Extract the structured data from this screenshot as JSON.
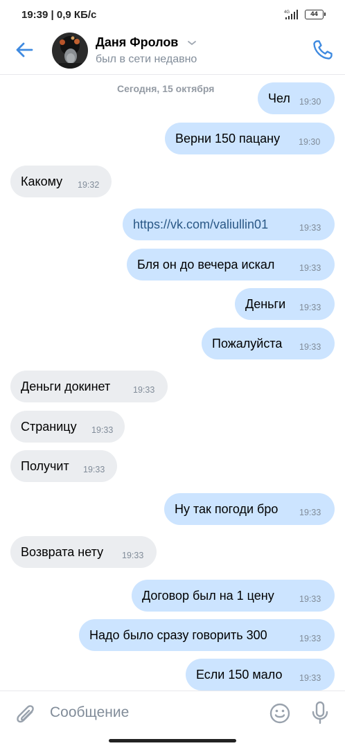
{
  "status_bar": {
    "time_speed": "19:39 | 0,9 КБ/с",
    "network": "4G",
    "battery": "44"
  },
  "header": {
    "contact_name": "Даня Фролов",
    "contact_status": "был в сети недавно",
    "icons": {
      "back": "arrow-left-icon",
      "chevron": "chevron-down-icon",
      "call": "phone-icon"
    }
  },
  "chat": {
    "date_separator": "Сегодня, 15 октября",
    "messages": [
      {
        "direction": "out",
        "text": "Чел",
        "time": "19:30"
      },
      {
        "direction": "out",
        "text": "Верни 150 пацану",
        "time": "19:30"
      },
      {
        "direction": "in",
        "text": "Какому",
        "time": "19:32"
      },
      {
        "direction": "out",
        "text": "https://vk.com/valiullin01",
        "time": "19:33",
        "link": true
      },
      {
        "direction": "out",
        "text": "Бля он до вечера искал",
        "time": "19:33"
      },
      {
        "direction": "out",
        "text": "Деньги",
        "time": "19:33"
      },
      {
        "direction": "out",
        "text": "Пожалуйста",
        "time": "19:33"
      },
      {
        "direction": "in",
        "text": "Деньги докинет",
        "time": "19:33"
      },
      {
        "direction": "in",
        "text": "Страницу",
        "time": "19:33"
      },
      {
        "direction": "in",
        "text": "Получит",
        "time": "19:33"
      },
      {
        "direction": "out",
        "text": "Ну так погоди бро",
        "time": "19:33"
      },
      {
        "direction": "in",
        "text": "Возврата нету",
        "time": "19:33"
      },
      {
        "direction": "out",
        "text": "Договор был на 1 цену",
        "time": "19:33"
      },
      {
        "direction": "out",
        "text": "Надо было сразу говорить 300",
        "time": "19:33"
      },
      {
        "direction": "out",
        "text": "Если 150 мало",
        "time": "19:33"
      }
    ]
  },
  "composer": {
    "placeholder": "Сообщение",
    "value": "",
    "icons": {
      "attach": "paperclip-icon",
      "emoji": "emoji-icon",
      "mic": "microphone-icon"
    }
  },
  "colors": {
    "accent": "#3f8ae0",
    "outgoing_bubble": "#cce4ff",
    "incoming_bubble": "#ebedf0",
    "secondary_text": "#818c99",
    "link": "#2a5885"
  }
}
